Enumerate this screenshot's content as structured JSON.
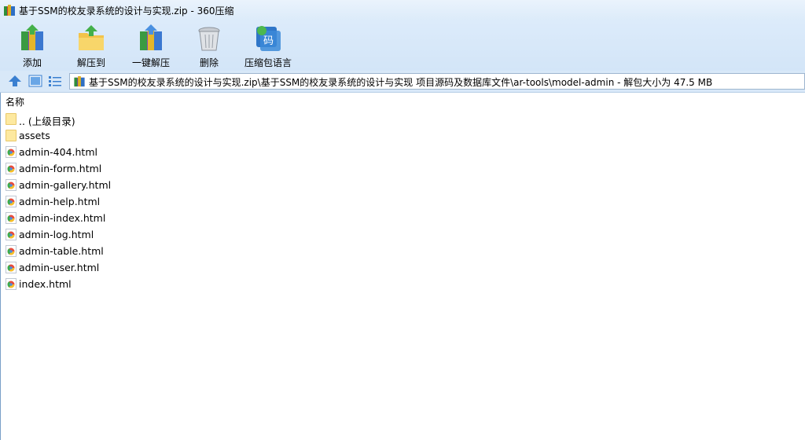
{
  "window": {
    "title": "基于SSM的校友录系统的设计与实现.zip - 360压缩",
    "app_icon": "archive-icon"
  },
  "toolbar": {
    "buttons": [
      {
        "label": "添加",
        "icon": "add-archive-icon"
      },
      {
        "label": "解压到",
        "icon": "extract-to-icon"
      },
      {
        "label": "一键解压",
        "icon": "one-click-extract-icon"
      },
      {
        "label": "删除",
        "icon": "trash-icon"
      },
      {
        "label": "压缩包语言",
        "icon": "archive-language-icon"
      }
    ]
  },
  "addressbar": {
    "path": "基于SSM的校友录系统的设计与实现.zip\\基于SSM的校友录系统的设计与实现 项目源码及数据库文件\\ar-tools\\model-admin - 解包大小为 47.5 MB",
    "nav_icons": [
      "up-arrow-icon",
      "thumbnail-view-icon",
      "list-view-icon"
    ]
  },
  "list": {
    "column_name": "名称",
    "items": [
      {
        "name": ".. (上级目录)",
        "type": "folder"
      },
      {
        "name": "assets",
        "type": "folder"
      },
      {
        "name": "admin-404.html",
        "type": "html"
      },
      {
        "name": "admin-form.html",
        "type": "html"
      },
      {
        "name": "admin-gallery.html",
        "type": "html"
      },
      {
        "name": "admin-help.html",
        "type": "html"
      },
      {
        "name": "admin-index.html",
        "type": "html"
      },
      {
        "name": "admin-log.html",
        "type": "html"
      },
      {
        "name": "admin-table.html",
        "type": "html"
      },
      {
        "name": "admin-user.html",
        "type": "html"
      },
      {
        "name": "index.html",
        "type": "html"
      }
    ]
  },
  "colors": {
    "titlebar": "#dcebfa",
    "toolbar": "#d3e5f8",
    "folder": "#fde9a0",
    "accent": "#3a7fd0"
  }
}
